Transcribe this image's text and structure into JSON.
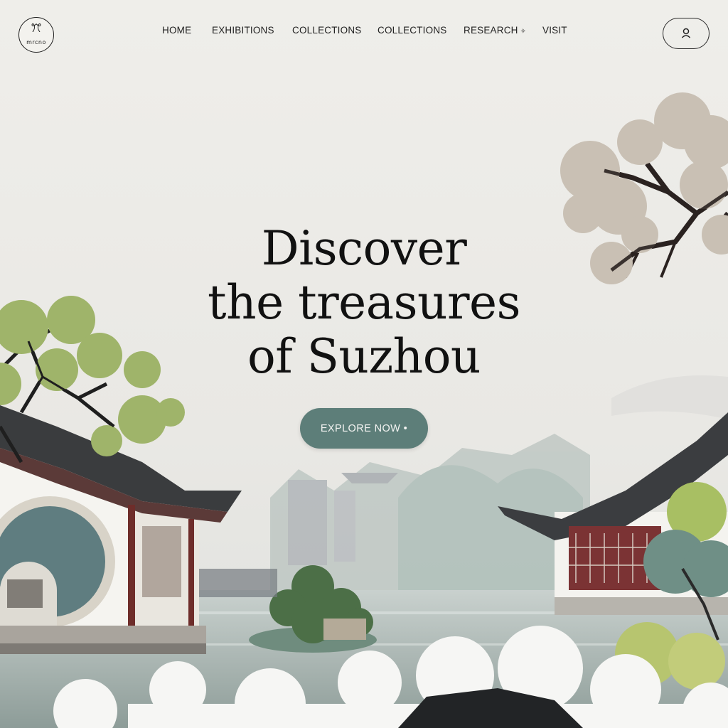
{
  "colors": {
    "page_background": "#ecebe7",
    "cta_background": "#5d7e79",
    "cta_text": "#f4f4f2",
    "text": "#111111"
  },
  "logo": {
    "glyph": "ꔫ",
    "text": "mrcno"
  },
  "nav": {
    "items": [
      {
        "label": "HOME"
      },
      {
        "label": "EXHIBITIONS"
      },
      {
        "label": "COLLECTIONS"
      },
      {
        "label": "COLLECTIONS"
      },
      {
        "label": "RESEARCH",
        "symbol": "✧"
      },
      {
        "label": "VISIT"
      }
    ],
    "account_icon": "user-icon"
  },
  "hero": {
    "title_lines": [
      "Discover",
      "the treasures",
      "of Suzhou"
    ],
    "cta_label": "EXPLORE NOW •"
  }
}
